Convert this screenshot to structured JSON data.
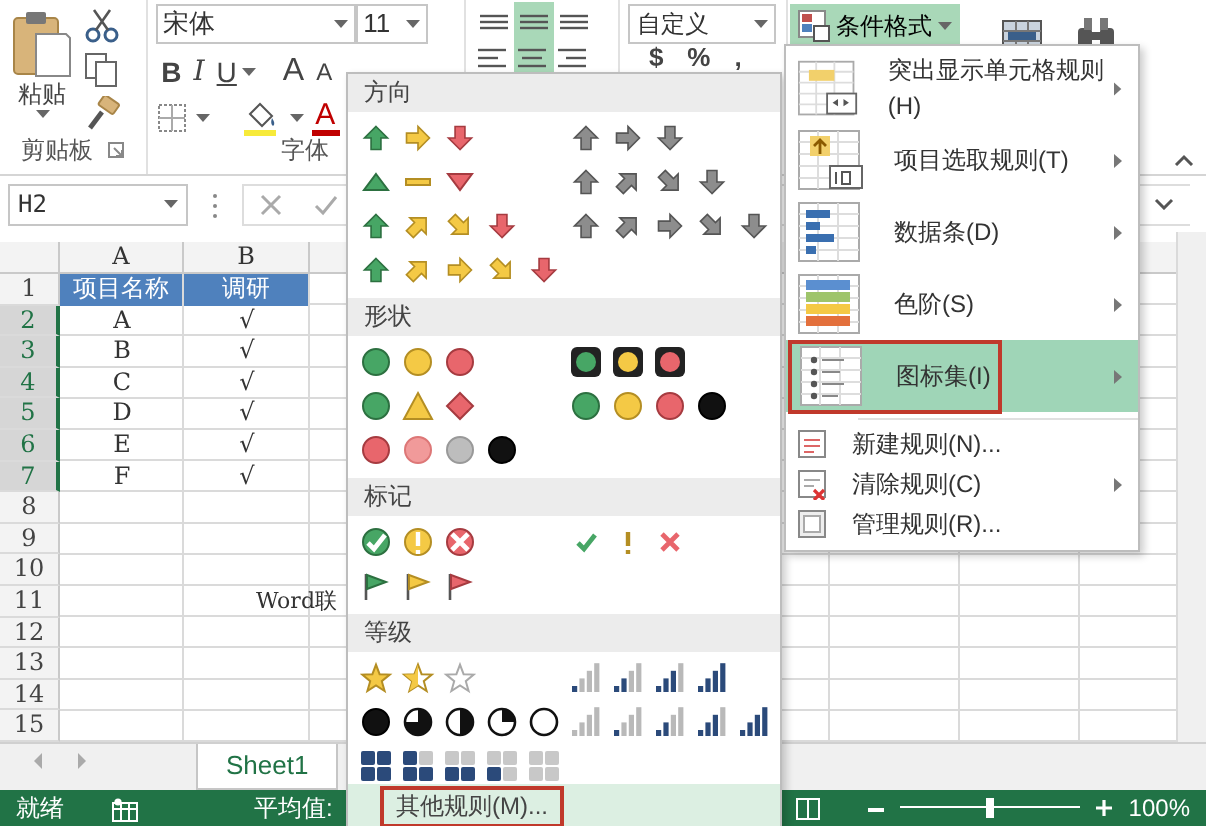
{
  "ribbon": {
    "clipboard": {
      "paste": "粘贴",
      "group_label": "剪贴板"
    },
    "font": {
      "font_name": "宋体",
      "font_size": "11",
      "buttons": [
        {
          "label": "B",
          "kind": "bold"
        },
        {
          "label": "I",
          "kind": "italic"
        },
        {
          "label": "U",
          "kind": "underline"
        },
        {
          "label": "A",
          "kind": "grow"
        },
        {
          "label": "A",
          "kind": "shrink"
        }
      ],
      "font_color": "A",
      "group_label": "字体"
    },
    "alignment": {
      "buttons": [
        {
          "kind": "top",
          "selected": false
        },
        {
          "kind": "middle",
          "selected": true
        },
        {
          "kind": "bottom",
          "selected": false
        },
        {
          "kind": "left",
          "selected": false
        },
        {
          "kind": "center",
          "selected": true
        },
        {
          "kind": "right",
          "selected": false
        }
      ]
    },
    "number": {
      "format": "自定义",
      "buttons": [
        "$",
        "%",
        ","
      ]
    },
    "conditional_formatting": {
      "label": "条件格式",
      "expanded": true
    }
  },
  "formula_bar": {
    "name_box": "H2"
  },
  "sheet": {
    "columns": [
      "A",
      "B"
    ],
    "rows": [
      {
        "number": "1",
        "selected": false,
        "kind": "header",
        "cells": [
          "项目名称",
          "调研"
        ]
      },
      {
        "number": "2",
        "selected": true,
        "cells": [
          "A",
          "√"
        ]
      },
      {
        "number": "3",
        "selected": true,
        "cells": [
          "B",
          "√"
        ]
      },
      {
        "number": "4",
        "selected": true,
        "cells": [
          "C",
          "√"
        ]
      },
      {
        "number": "5",
        "selected": true,
        "cells": [
          "D",
          "√"
        ]
      },
      {
        "number": "6",
        "selected": true,
        "cells": [
          "E",
          "√"
        ]
      },
      {
        "number": "7",
        "selected": true,
        "cells": [
          "F",
          "√"
        ]
      },
      {
        "number": "8",
        "selected": false
      },
      {
        "number": "9",
        "selected": false
      },
      {
        "number": "10",
        "selected": false
      },
      {
        "number": "11",
        "selected": false,
        "overflow_text": "Word联"
      },
      {
        "number": "12",
        "selected": false
      },
      {
        "number": "13",
        "selected": false
      },
      {
        "number": "14",
        "selected": false
      },
      {
        "number": "15",
        "selected": false
      }
    ]
  },
  "sheet_tabs": [
    {
      "label": "Sheet1",
      "selected": true
    }
  ],
  "status_bar": {
    "ready": "就绪",
    "average": "平均值:",
    "zoom": {
      "level": 0.5,
      "reading": "100%"
    }
  },
  "icon_sets_menu": {
    "sections": [
      {
        "title": "方向",
        "kind": "direction"
      },
      {
        "title": "形状",
        "kind": "shape"
      },
      {
        "title": "标记",
        "kind": "indicator"
      },
      {
        "title": "等级",
        "kind": "rating"
      }
    ],
    "more_rules": "其他规则(M)..."
  },
  "conditional_formatting_menu": {
    "items": [
      {
        "label": "突出显示单元格规则(H)",
        "kind": "highlight",
        "submenu": true,
        "selected": false
      },
      {
        "label": "项目选取规则(T)",
        "kind": "top-bottom",
        "submenu": true,
        "selected": false
      },
      {
        "label": "数据条(D)",
        "kind": "data-bars",
        "submenu": true,
        "selected": false
      },
      {
        "label": "色阶(S)",
        "kind": "color-scales",
        "submenu": true,
        "selected": false
      },
      {
        "label": "图标集(I)",
        "kind": "icon-sets",
        "submenu": true,
        "selected": true
      },
      {
        "label": "新建规则(N)...",
        "kind": "new",
        "submenu": false,
        "selected": false
      },
      {
        "label": "清除规则(C)",
        "kind": "clear",
        "submenu": true,
        "selected": false
      },
      {
        "label": "管理规则(R)...",
        "kind": "manage",
        "submenu": false,
        "selected": false
      }
    ]
  }
}
